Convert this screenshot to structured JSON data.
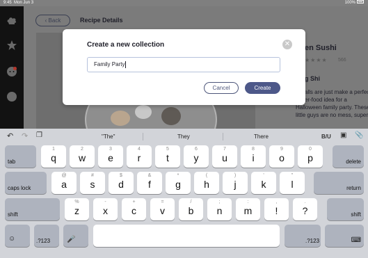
{
  "status_bar": {
    "time": "9:45",
    "date": "Mon Jun 3",
    "battery": "100%"
  },
  "sidebar": {
    "icons": [
      "chef-hat-icon",
      "star-icon",
      "chat-icon",
      "face-icon"
    ]
  },
  "app": {
    "back_label": "Back",
    "page_title": "Recipe Details",
    "recipe_title": "en Sushi",
    "rating_count": "566",
    "section_title": "g Shi",
    "description": "hi balls are just make a perfect finger-food idea for a Halloween family party. These little guys are no mess, super"
  },
  "modal": {
    "title": "Create a new collection",
    "input_value": "Family Party",
    "cancel_label": "Cancel",
    "create_label": "Create"
  },
  "keyboard": {
    "suggestions": [
      "\"The\"",
      "They",
      "There"
    ],
    "format_label": "B/U",
    "row1": [
      {
        "k": "q",
        "h": "1"
      },
      {
        "k": "w",
        "h": "2"
      },
      {
        "k": "e",
        "h": "3"
      },
      {
        "k": "r",
        "h": "4"
      },
      {
        "k": "t",
        "h": "5"
      },
      {
        "k": "y",
        "h": "6"
      },
      {
        "k": "u",
        "h": "7"
      },
      {
        "k": "i",
        "h": "8"
      },
      {
        "k": "o",
        "h": "9"
      },
      {
        "k": "p",
        "h": "0"
      }
    ],
    "row2": [
      {
        "k": "a",
        "h": "@"
      },
      {
        "k": "s",
        "h": "#"
      },
      {
        "k": "d",
        "h": "$"
      },
      {
        "k": "f",
        "h": "&"
      },
      {
        "k": "g",
        "h": "*"
      },
      {
        "k": "h",
        "h": "("
      },
      {
        "k": "j",
        "h": ")"
      },
      {
        "k": "k",
        "h": "'"
      },
      {
        "k": "l",
        "h": "\""
      }
    ],
    "row3": [
      {
        "k": "z",
        "h": "%"
      },
      {
        "k": "x",
        "h": "-"
      },
      {
        "k": "c",
        "h": "+"
      },
      {
        "k": "v",
        "h": "="
      },
      {
        "k": "b",
        "h": "/"
      },
      {
        "k": "n",
        "h": ";"
      },
      {
        "k": "m",
        "h": ":"
      },
      {
        "k": "!",
        "h": ","
      },
      {
        "k": "?",
        "h": "."
      }
    ],
    "tab_label": "tab",
    "delete_label": "delete",
    "caps_label": "caps lock",
    "return_label": "return",
    "shift_label": "shift",
    "num_label": ".?123"
  }
}
